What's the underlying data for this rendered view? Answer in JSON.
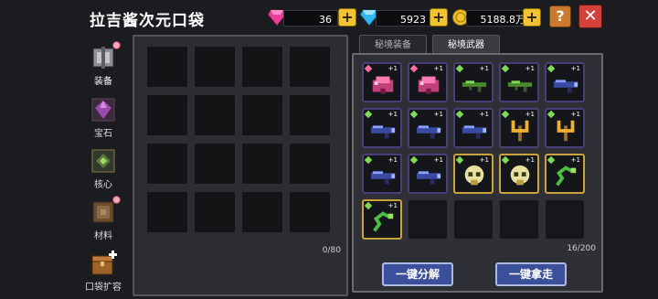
{
  "title": "拉吉酱次元口袋",
  "currencies": [
    {
      "name": "gem-icon",
      "value": "36",
      "color": "#e8409c"
    },
    {
      "name": "diamond-icon",
      "value": "5923",
      "color": "#35b8f0"
    },
    {
      "name": "coin-icon",
      "value": "5188.8万",
      "color": "#f1c232"
    }
  ],
  "plus_label": "+",
  "help_label": "?",
  "close_label": "✕",
  "sidebar": {
    "items": [
      {
        "label": "装备",
        "icon": "armor-icon",
        "active": true,
        "dot": true
      },
      {
        "label": "宝石",
        "icon": "gem-icon",
        "active": false,
        "dot": false
      },
      {
        "label": "核心",
        "icon": "core-icon",
        "active": false,
        "dot": false
      },
      {
        "label": "材料",
        "icon": "material-icon",
        "active": false,
        "dot": true
      },
      {
        "label": "口袋扩容",
        "icon": "chest-plus-icon",
        "active": false,
        "dot": false
      }
    ]
  },
  "storage": {
    "count": "0/80"
  },
  "tabs": [
    {
      "label": "秘境装备",
      "active": false
    },
    {
      "label": "秘境武器",
      "active": true
    }
  ],
  "weapons": {
    "count": "16/200",
    "items": [
      {
        "icon": "pink-flower-weapon-icon",
        "level": "+1",
        "gem": "#ff6ea0",
        "rarity": "purple"
      },
      {
        "icon": "pink-flower-weapon-icon",
        "level": "+1",
        "gem": "#ff6ea0",
        "rarity": "purple"
      },
      {
        "icon": "green-rifle-icon",
        "level": "+1",
        "gem": "#7ed957",
        "rarity": "purple"
      },
      {
        "icon": "green-rifle-icon",
        "level": "+1",
        "gem": "#7ed957",
        "rarity": "purple"
      },
      {
        "icon": "blue-launcher-icon",
        "level": "+1",
        "gem": "#7ed957",
        "rarity": "purple"
      },
      {
        "icon": "blue-launcher-icon",
        "level": "+1",
        "gem": "#7ed957",
        "rarity": "purple"
      },
      {
        "icon": "blue-launcher-icon",
        "level": "+1",
        "gem": "#7ed957",
        "rarity": "purple"
      },
      {
        "icon": "blue-launcher-icon",
        "level": "+1",
        "gem": "#7ed957",
        "rarity": "purple"
      },
      {
        "icon": "golden-trident-icon",
        "level": "+1",
        "gem": "#7ed957",
        "rarity": "purple"
      },
      {
        "icon": "golden-trident-icon",
        "level": "+1",
        "gem": "#7ed957",
        "rarity": "purple"
      },
      {
        "icon": "blue-launcher-icon",
        "level": "+1",
        "gem": "#7ed957",
        "rarity": "purple"
      },
      {
        "icon": "blue-launcher-icon",
        "level": "+1",
        "gem": "#7ed957",
        "rarity": "purple"
      },
      {
        "icon": "golden-skull-icon",
        "level": "+1",
        "gem": "#7ed957",
        "rarity": "gold"
      },
      {
        "icon": "golden-skull-icon",
        "level": "+1",
        "gem": "#7ed957",
        "rarity": "gold"
      },
      {
        "icon": "green-serpent-icon",
        "level": "+1",
        "gem": "#7ed957",
        "rarity": "gold"
      },
      {
        "icon": "green-serpent-icon",
        "level": "+1",
        "gem": "#7ed957",
        "rarity": "gold"
      }
    ]
  },
  "buttons": {
    "dismantle": "一键分解",
    "collect": "一键拿走"
  }
}
